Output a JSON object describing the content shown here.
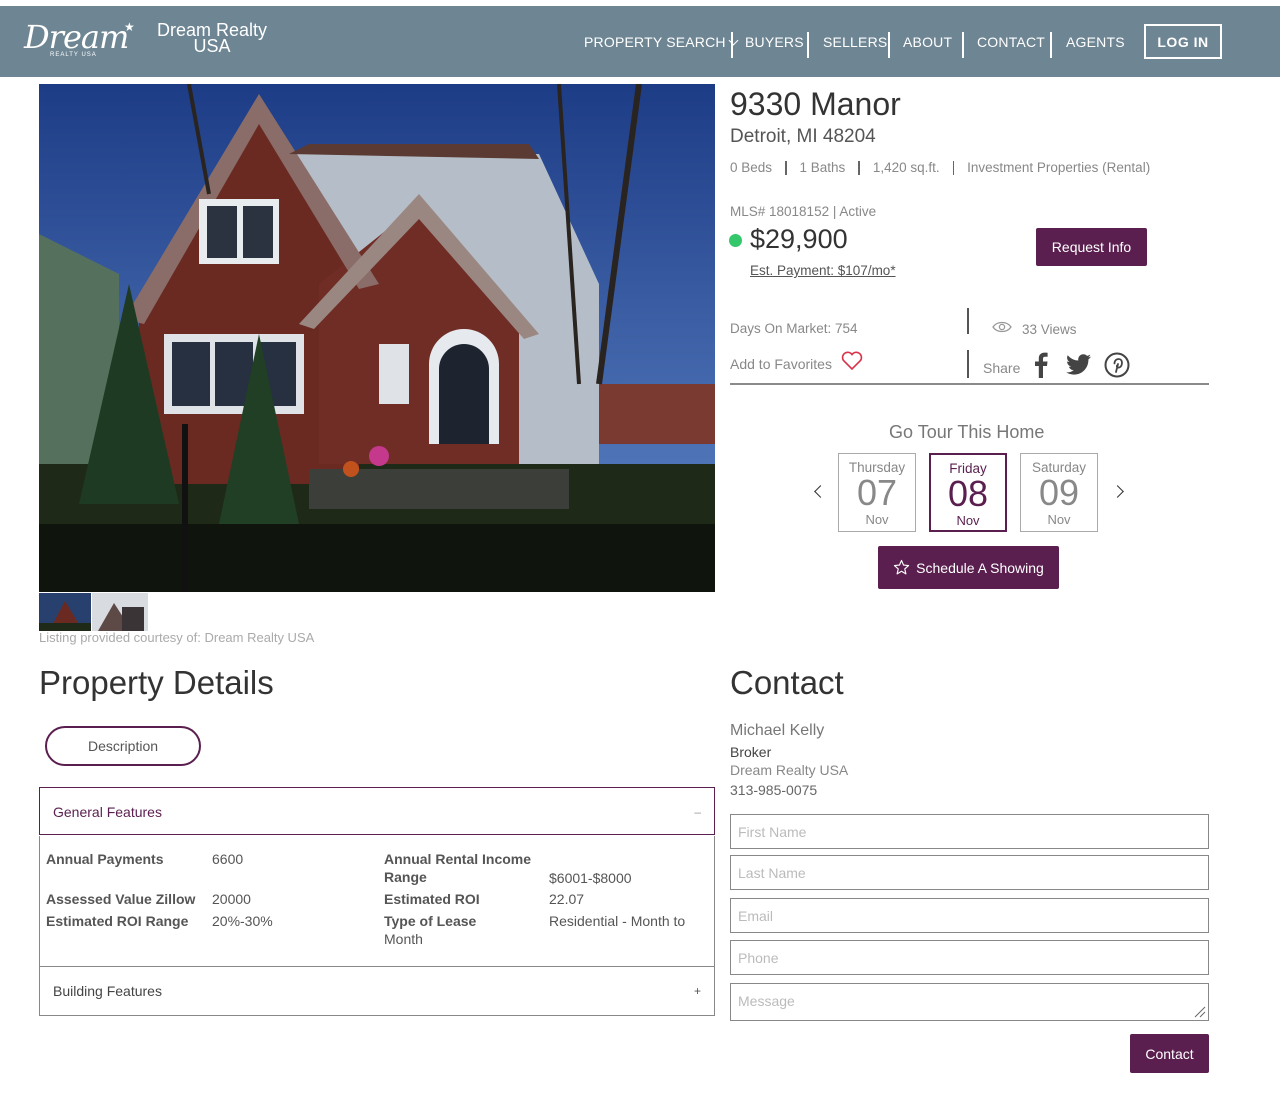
{
  "header": {
    "logo_script": "Dream",
    "logo_sub": "REALTY USA",
    "brand_line1": "Dream Realty",
    "brand_line2": "USA",
    "nav": {
      "property_search": "PROPERTY SEARCH",
      "buyers": "BUYERS",
      "sellers": "SELLERS",
      "about": "ABOUT",
      "contact": "CONTACT",
      "agents": "AGENTS"
    },
    "login": "LOG IN",
    "colors": {
      "bar": "#6e8593",
      "text": "#ffffff"
    }
  },
  "listing": {
    "address_line1": "9330 Manor",
    "address_line2": "Detroit, MI 48204",
    "beds": "0 Beds",
    "baths": "1 Baths",
    "sqft": "1,420 sq.ft.",
    "type": "Investment Properties (Rental)",
    "mls": "MLS# 18018152 | Active",
    "price": "$29,900",
    "est_payment": "Est. Payment: $107/mo*",
    "request_info": "Request Info",
    "days_on_market": "Days On Market: 754",
    "views": "33 Views",
    "add_favorites": "Add to Favorites",
    "share": "Share",
    "courtesy": "Listing provided courtesy of: Dream Realty USA",
    "status_color": "#34c76c",
    "accent_color": "#5a1f4f"
  },
  "tour": {
    "title": "Go Tour This Home",
    "days": [
      {
        "weekday": "Thursday",
        "day": "07",
        "month": "Nov"
      },
      {
        "weekday": "Friday",
        "day": "08",
        "month": "Nov"
      },
      {
        "weekday": "Saturday",
        "day": "09",
        "month": "Nov"
      }
    ],
    "selected_index": 1,
    "schedule_label": "Schedule A Showing"
  },
  "details": {
    "title": "Property Details",
    "description_tab": "Description",
    "general_features": "General Features",
    "collapse_symbol": "–",
    "expand_symbol": "+",
    "building_features": "Building Features",
    "features": {
      "annual_payments_label": "Annual Payments",
      "annual_payments_value": "6600",
      "assessed_label": "Assessed Value Zillow",
      "assessed_value": "20000",
      "roi_range_label": "Estimated ROI Range",
      "roi_range_value": "20%-30%",
      "rental_income_label_1": "Annual Rental Income",
      "rental_income_label_2": "Range",
      "rental_income_value": "$6001-$8000",
      "roi_label": "Estimated ROI",
      "roi_value": "22.07",
      "lease_label": "Type of Lease",
      "lease_value_1": "Residential - Month to",
      "lease_value_2": "Month"
    }
  },
  "contact": {
    "title": "Contact",
    "agent_name": "Michael Kelly",
    "agent_role": "Broker",
    "agent_company": "Dream Realty USA",
    "agent_phone": "313-985-0075",
    "first_name_ph": "First Name",
    "last_name_ph": "Last Name",
    "email_ph": "Email",
    "phone_ph": "Phone",
    "message_ph": "Message",
    "submit": "Contact"
  }
}
